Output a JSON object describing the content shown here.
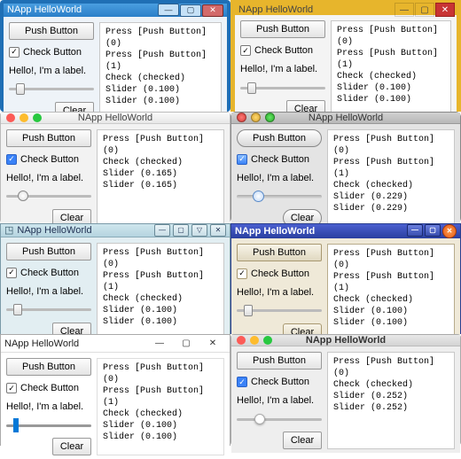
{
  "windows": [
    {
      "title": "NApp HelloWorld",
      "push_button": "Push Button",
      "check_button": "Check Button",
      "check_checked": true,
      "label": "Hello!, I'm a label.",
      "slider_pos": 0.1,
      "clear": "Clear",
      "log": [
        "Press [Push Button] (0)",
        "Press [Push Button] (1)",
        "Check (checked)",
        "Slider (0.100)",
        "Slider (0.100)"
      ],
      "winbtns": [
        "—",
        "▢",
        "✕"
      ]
    },
    {
      "title": "NApp HelloWorld",
      "push_button": "Push Button",
      "check_button": "Check Button",
      "check_checked": true,
      "label": "Hello!, I'm a label.",
      "slider_pos": 0.1,
      "clear": "Clear",
      "log": [
        "Press [Push Button] (0)",
        "Press [Push Button] (1)",
        "Check (checked)",
        "Slider (0.100)",
        "Slider (0.100)"
      ],
      "winbtns": [
        "—",
        "▢",
        "✕"
      ]
    },
    {
      "title": "NApp HelloWorld",
      "push_button": "Push Button",
      "check_button": "Check Button",
      "check_checked": true,
      "label": "Hello!, I'm a label.",
      "slider_pos": 0.165,
      "clear": "Clear",
      "log": [
        "Press [Push Button] (0)",
        "Check (checked)",
        "Slider (0.165)",
        "Slider (0.165)"
      ]
    },
    {
      "title": "NApp HelloWorld",
      "push_button": "Push Button",
      "check_button": "Check Button",
      "check_checked": true,
      "label": "Hello!, I'm a label.",
      "slider_pos": 0.229,
      "clear": "Clear",
      "log": [
        "Press [Push Button] (0)",
        "Press [Push Button] (1)",
        "Check (checked)",
        "Slider (0.229)",
        "Slider (0.229)"
      ]
    },
    {
      "title": "NApp HelloWorld",
      "push_button": "Push Button",
      "check_button": "Check Button",
      "check_checked": true,
      "label": "Hello!, I'm a label.",
      "slider_pos": 0.1,
      "clear": "Clear",
      "log": [
        "Press [Push Button] (0)",
        "Press [Push Button] (1)",
        "Check (checked)",
        "Slider (0.100)",
        "Slider (0.100)"
      ],
      "winbtns": [
        "—",
        "▢",
        "▽",
        "✕"
      ]
    },
    {
      "title": "NApp HelloWorld",
      "push_button": "Push Button",
      "check_button": "Check Button",
      "check_checked": true,
      "label": "Hello!, I'm a label.",
      "slider_pos": 0.1,
      "clear": "Clear",
      "log": [
        "Press [Push Button] (0)",
        "Press [Push Button] (1)",
        "Check (checked)",
        "Slider (0.100)",
        "Slider (0.100)"
      ],
      "winbtns": [
        "—",
        "▢",
        "✕"
      ]
    },
    {
      "title": "NApp HelloWorld",
      "push_button": "Push Button",
      "check_button": "Check Button",
      "check_checked": true,
      "label": "Hello!, I'm a label.",
      "slider_pos": 0.1,
      "clear": "Clear",
      "log": [
        "Press [Push Button] (0)",
        "Press [Push Button] (1)",
        "Check (checked)",
        "Slider (0.100)",
        "Slider (0.100)"
      ],
      "winbtns": [
        "—",
        "▢",
        "✕"
      ]
    },
    {
      "title": "NApp HelloWorld",
      "push_button": "Push Button",
      "check_button": "Check Button",
      "check_checked": true,
      "label": "Hello!, I'm a label.",
      "slider_pos": 0.252,
      "clear": "Clear",
      "log": [
        "Press [Push Button] (0)",
        "Check (checked)",
        "Slider (0.252)",
        "Slider (0.252)"
      ]
    }
  ]
}
